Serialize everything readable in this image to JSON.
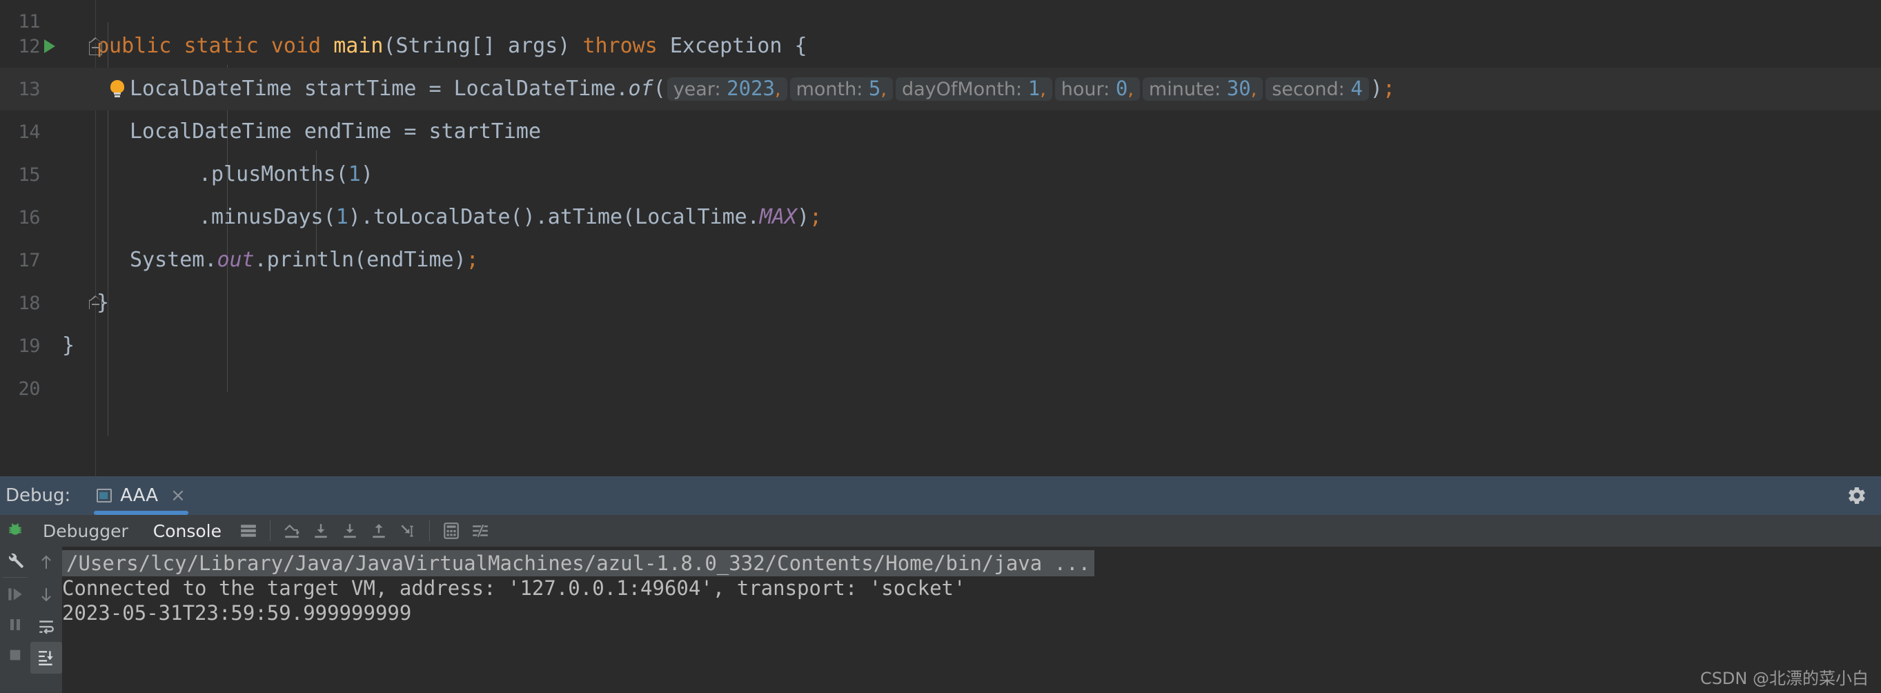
{
  "editor": {
    "lines": [
      {
        "no": "11",
        "text": ""
      },
      {
        "no": "12",
        "text": "public static void main(String[] args) throws Exception {"
      },
      {
        "no": "13",
        "text": "LocalDateTime startTime = LocalDateTime.of( year: 2023, month: 5, dayOfMonth: 1, hour: 0, minute: 30, second: 4);"
      },
      {
        "no": "14",
        "text": "LocalDateTime endTime = startTime"
      },
      {
        "no": "15",
        "text": ".plusMonths(1)"
      },
      {
        "no": "16",
        "text": ".minusDays(1).toLocalDate().atTime(LocalTime.MAX);"
      },
      {
        "no": "17",
        "text": "System.out.println(endTime);"
      },
      {
        "no": "18",
        "text": "}"
      },
      {
        "no": "19",
        "text": "}"
      },
      {
        "no": "20",
        "text": ""
      }
    ],
    "line12": {
      "kw_public": "public",
      "kw_static": "static",
      "kw_void": "void",
      "method": "main",
      "params": "(String[] args)",
      "kw_throws": "throws",
      "exception": "Exception",
      "brace": "{"
    },
    "line13": {
      "type": "LocalDateTime",
      "varname": "startTime",
      "assign": "=",
      "cls": "LocalDateTime",
      "dot": ".",
      "factory": "of",
      "open": "(",
      "hints": [
        {
          "label": "year:",
          "value": "2023"
        },
        {
          "label": "month:",
          "value": "5"
        },
        {
          "label": "dayOfMonth:",
          "value": "1"
        },
        {
          "label": "hour:",
          "value": "0"
        },
        {
          "label": "minute:",
          "value": "30"
        },
        {
          "label": "second:",
          "value": "4"
        }
      ],
      "comma": ",",
      "close": ")",
      "semi": ";"
    },
    "line14": {
      "type": "LocalDateTime",
      "varname": "endTime",
      "assign": "=",
      "value": "startTime"
    },
    "line15": {
      "call": ".plusMonths(",
      "arg": "1",
      "close": ")"
    },
    "line16": {
      "call1": ".minusDays(",
      "arg1": "1",
      "mid": ").toLocalDate().atTime(LocalTime.",
      "field": "MAX",
      "close": ")",
      "semi": ";"
    },
    "line17": {
      "sys": "System.",
      "out": "out",
      "print": ".println(endTime)",
      "semi": ";"
    },
    "line18": {
      "brace": "}"
    },
    "line19": {
      "brace": "}"
    },
    "icons": {
      "run_marker": "run-gutter-icon",
      "bulb": "intention-bulb-icon",
      "fold_12": "code-fold-icon",
      "fold_18": "code-fold-icon"
    }
  },
  "debug_header": {
    "label": "Debug:",
    "tab_title": "AAA",
    "close_glyph": "×",
    "settings_icon": "gear-icon",
    "accent": "#4a88c7",
    "bg": "#3c4b5c"
  },
  "debug_toolbar": {
    "tabs": [
      {
        "label": "Debugger",
        "active": false
      },
      {
        "label": "Console",
        "active": true
      }
    ],
    "icons": [
      "layout-settings-icon",
      "step-over-icon",
      "step-into-icon",
      "force-step-into-icon",
      "step-out-icon",
      "run-to-cursor-icon",
      "evaluate-expression-icon",
      "filter-icon"
    ]
  },
  "left_rail": {
    "icons": [
      "debug-bug-icon",
      "settings-wrench-icon",
      "resume-program-icon",
      "pause-program-icon",
      "stop-program-icon"
    ]
  },
  "console_rail": {
    "icons": [
      "scroll-up-icon",
      "scroll-down-icon",
      "soft-wrap-icon",
      "scroll-to-end-icon"
    ]
  },
  "console": {
    "lines": [
      {
        "text": "/Users/lcy/Library/Java/JavaVirtualMachines/azul-1.8.0_332/Contents/Home/bin/java ...",
        "highlighted": true
      },
      {
        "text": "Connected to the target VM, address: '127.0.0.1:49604', transport: 'socket'",
        "highlighted": false
      },
      {
        "text": "2023-05-31T23:59:59.999999999",
        "highlighted": false
      }
    ]
  },
  "watermark": {
    "text": "CSDN @北漂的菜小白"
  },
  "colors": {
    "editor_bg": "#2b2b2b",
    "current_line_bg": "#323232",
    "gutter_text": "#606366",
    "keyword": "#cc7832",
    "method": "#ffc66d",
    "number": "#6897bb",
    "field": "#9876aa",
    "default_text": "#a9b7c6",
    "hint_bg": "#3b3f41",
    "hint_text": "#8c8c8c",
    "panel_bg": "#3c3f41",
    "debug_header_bg": "#3c4b5c",
    "tab_accent": "#4a88c7",
    "console_text": "#bbbbbb",
    "run_green": "#499c54",
    "bulb_orange": "#f5a623"
  }
}
